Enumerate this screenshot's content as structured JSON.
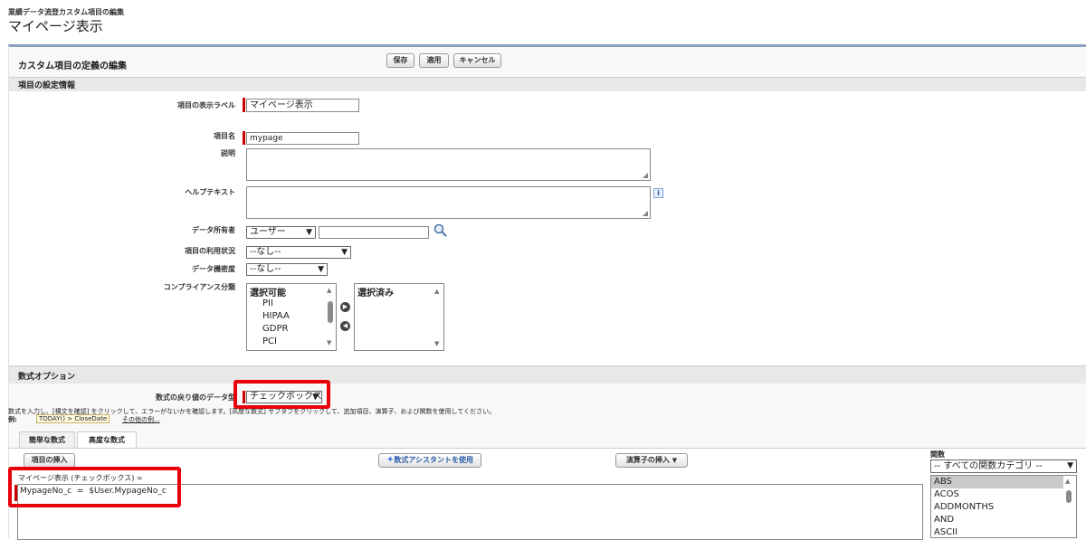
{
  "page": {
    "breadcrumb": "業績データ流登カスタム項目の編集",
    "title": "マイページ表示"
  },
  "header": {
    "title": "カスタム項目の定義の編集",
    "save": "保存",
    "apply": "適用",
    "cancel": "キャンセル"
  },
  "settings": {
    "section_title": "項目の設定情報",
    "label_label": "項目の表示ラベル",
    "label_value": "マイページ表示",
    "name_label": "項目名",
    "name_value": "mypage",
    "desc_label": "説明",
    "help_label": "ヘルプテキスト",
    "owner_label": "データ所有者",
    "owner_value": "ユーザー",
    "usage_label": "項目の利用状況",
    "usage_value": "--なし--",
    "sensitivity_label": "データ機密度",
    "sensitivity_value": "--なし--",
    "compliance_label": "コンプライアンス分類",
    "available_title": "選択可能",
    "available": [
      "PII",
      "HIPAA",
      "GDPR",
      "PCI"
    ],
    "selected_title": "選択済み"
  },
  "formula": {
    "section_title": "数式オプション",
    "return_type_label": "数式の戻り値のデータ型",
    "return_type_value": "チェックボックス",
    "help_text": "数式を入力し、[構文を確認] をクリックして、エラーがないかを確認します。[高度な数式] サブタブをクリックして、追加項目、演算子、および関数を使用してください。",
    "example_label": "例:",
    "example_code": "TODAY() > CloseDate",
    "example_more": "その他の例...",
    "tab_simple": "簡単な数式",
    "tab_advanced": "高度な数式",
    "insert_field": "項目の挿入",
    "assistant": "数式アシスタントを使用",
    "insert_operator": "演算子の挿入",
    "expression_header": "マイページ表示 (チェックボックス) =",
    "expression": "MypageNo_c  =  $User.MypageNo_c",
    "functions_label": "関数",
    "functions_category": "-- すべての関数カテゴリ --",
    "functions": [
      "ABS",
      "ACOS",
      "ADDMONTHS",
      "AND",
      "ASCII"
    ]
  },
  "colors": {
    "required": "#cc0000",
    "highlight": "#e8000b",
    "section_bg": "#e8e8e8"
  }
}
